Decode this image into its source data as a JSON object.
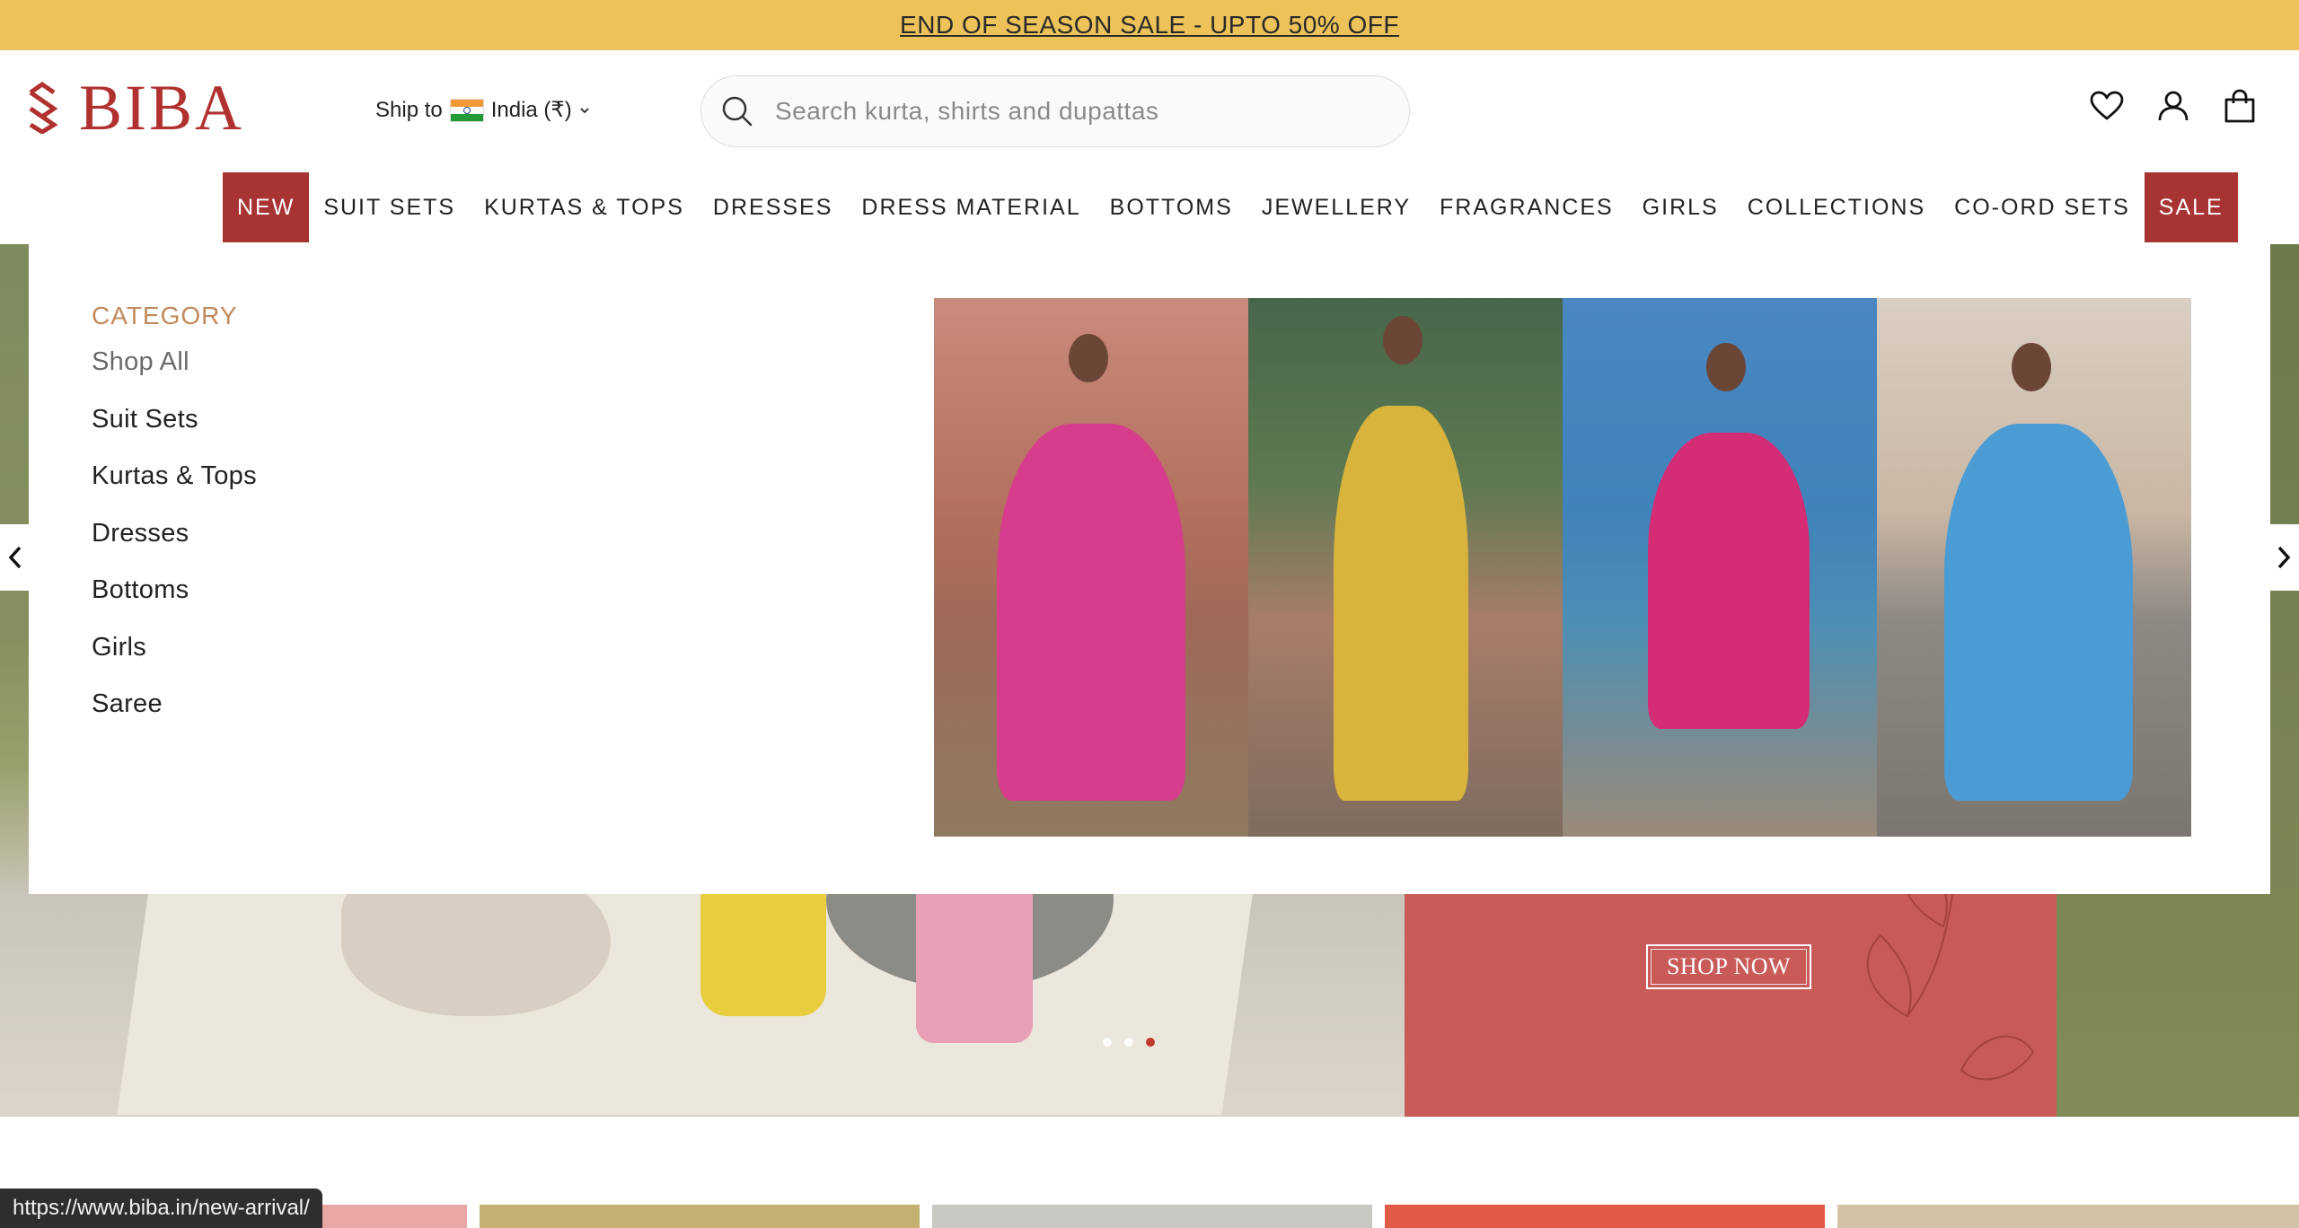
{
  "banner": {
    "text": "END OF SEASON SALE - UPTO 50% OFF"
  },
  "brand": {
    "name": "BIBA",
    "color": "#b0312f"
  },
  "ship_to": {
    "label": "Ship to",
    "country": "India (₹)"
  },
  "search": {
    "placeholder": "Search kurta, shirts and dupattas"
  },
  "header_icons": [
    "heart-icon",
    "user-icon",
    "bag-icon"
  ],
  "nav": {
    "items": [
      {
        "label": "NEW",
        "highlight": true,
        "active": true
      },
      {
        "label": "SUIT SETS"
      },
      {
        "label": "KURTAS & TOPS"
      },
      {
        "label": "DRESSES"
      },
      {
        "label": "DRESS MATERIAL"
      },
      {
        "label": "BOTTOMS"
      },
      {
        "label": "JEWELLERY"
      },
      {
        "label": "FRAGRANCES"
      },
      {
        "label": "GIRLS"
      },
      {
        "label": "COLLECTIONS"
      },
      {
        "label": "CO-ORD SETS"
      },
      {
        "label": "SALE",
        "highlight": true
      }
    ]
  },
  "mega_menu": {
    "heading": "CATEGORY",
    "items": [
      "Shop All",
      "Suit Sets",
      "Kurtas & Tops",
      "Dresses",
      "Bottoms",
      "Girls",
      "Saree"
    ]
  },
  "hero": {
    "cta": "SHOP NOW",
    "slides": 3,
    "active_slide": 3
  },
  "status_bar": {
    "url": "https://www.biba.in/new-arrival/"
  },
  "colors": {
    "banner": "#ecc259",
    "accent": "#a83333",
    "category_heading": "#c08a5c",
    "hero_panel": "#c85b58"
  }
}
